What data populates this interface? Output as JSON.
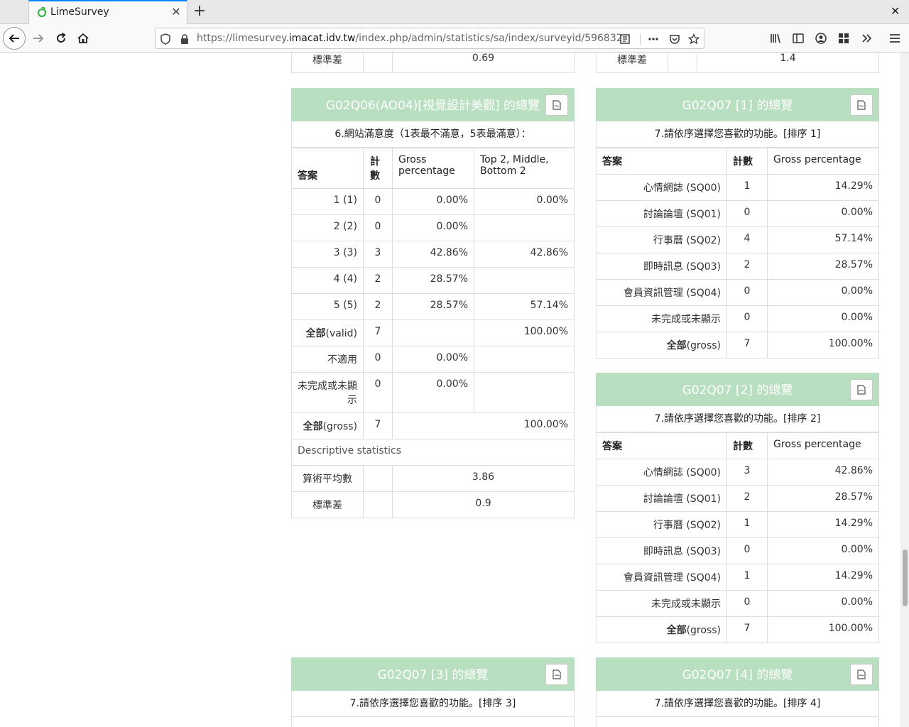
{
  "browser": {
    "tab_title": "LimeSurvey",
    "url_prefix": "https://limesurvey.",
    "url_domain": "imacat.idv.tw",
    "url_path": "/index.php/admin/statistics/sa/index/surveyid/596832"
  },
  "top_partial": {
    "left": {
      "label": "標準差",
      "value": "0.69"
    },
    "right": {
      "label": "標準差",
      "value": "1.4"
    }
  },
  "g02q06": {
    "header": "G02Q06(AO04)[視覺設計美觀] 的總覽",
    "question": "6.網站滿意度（1表最不滿意，5表最滿意）：",
    "col_answer": "答案",
    "col_count": "計數",
    "col_gross": "Gross percentage",
    "col_top": "Top 2, Middle, Bottom 2",
    "rows": [
      {
        "answer": "1 (1)",
        "count": "0",
        "gross": "0.00%",
        "top": "0.00%"
      },
      {
        "answer": "2 (2)",
        "count": "0",
        "gross": "0.00%",
        "top": ""
      },
      {
        "answer": "3 (3)",
        "count": "3",
        "gross": "42.86%",
        "top": "42.86%"
      },
      {
        "answer": "4 (4)",
        "count": "2",
        "gross": "28.57%",
        "top": ""
      },
      {
        "answer": "5 (5)",
        "count": "2",
        "gross": "28.57%",
        "top": "57.14%"
      }
    ],
    "valid": {
      "label_bold": "全部",
      "label_rest": "(valid)",
      "count": "7",
      "pct": "100.00%"
    },
    "na": {
      "label": "不適用",
      "count": "0",
      "pct": "0.00%"
    },
    "incomplete": {
      "label": "未完成或未顯示",
      "count": "0",
      "pct": "0.00%"
    },
    "gross": {
      "label_bold": "全部",
      "label_rest": "(gross)",
      "count": "7",
      "pct": "100.00%"
    },
    "desc_label": "Descriptive statistics",
    "mean": {
      "label": "算術平均數",
      "value": "3.86"
    },
    "sd": {
      "label": "標準差",
      "value": "0.9"
    }
  },
  "g02q07_1": {
    "header": "G02Q07 [1] 的總覽",
    "question": "7.請依序選擇您喜歡的功能。[排序 1]",
    "col_answer": "答案",
    "col_count": "計數",
    "col_gross": "Gross percentage",
    "rows": [
      {
        "answer": "心情網誌 (SQ00)",
        "count": "1",
        "gross": "14.29%"
      },
      {
        "answer": "討論論壇 (SQ01)",
        "count": "0",
        "gross": "0.00%"
      },
      {
        "answer": "行事曆 (SQ02)",
        "count": "4",
        "gross": "57.14%"
      },
      {
        "answer": "即時訊息 (SQ03)",
        "count": "2",
        "gross": "28.57%"
      },
      {
        "answer": "會員資訊管理 (SQ04)",
        "count": "0",
        "gross": "0.00%"
      },
      {
        "answer": "未完成或未顯示",
        "count": "0",
        "gross": "0.00%"
      }
    ],
    "gross": {
      "label_bold": "全部",
      "label_rest": "(gross)",
      "count": "7",
      "pct": "100.00%"
    }
  },
  "g02q07_2": {
    "header": "G02Q07 [2] 的總覽",
    "question": "7.請依序選擇您喜歡的功能。[排序 2]",
    "col_answer": "答案",
    "col_count": "計數",
    "col_gross": "Gross percentage",
    "rows": [
      {
        "answer": "心情網誌 (SQ00)",
        "count": "3",
        "gross": "42.86%"
      },
      {
        "answer": "討論論壇 (SQ01)",
        "count": "2",
        "gross": "28.57%"
      },
      {
        "answer": "行事曆 (SQ02)",
        "count": "1",
        "gross": "14.29%"
      },
      {
        "answer": "即時訊息 (SQ03)",
        "count": "0",
        "gross": "0.00%"
      },
      {
        "answer": "會員資訊管理 (SQ04)",
        "count": "1",
        "gross": "14.29%"
      },
      {
        "answer": "未完成或未顯示",
        "count": "0",
        "gross": "0.00%"
      }
    ],
    "gross": {
      "label_bold": "全部",
      "label_rest": "(gross)",
      "count": "7",
      "pct": "100.00%"
    }
  },
  "g02q07_3": {
    "header": "G02Q07 [3] 的總覽",
    "question": "7.請依序選擇您喜歡的功能。[排序 3]"
  },
  "g02q07_4": {
    "header": "G02Q07 [4] 的總覽",
    "question": "7.請依序選擇您喜歡的功能。[排序 4]"
  },
  "colors": {
    "card_header": "#b8dfbf",
    "tab_accent": "#0a84ff",
    "favicon": "#3cb34a"
  }
}
